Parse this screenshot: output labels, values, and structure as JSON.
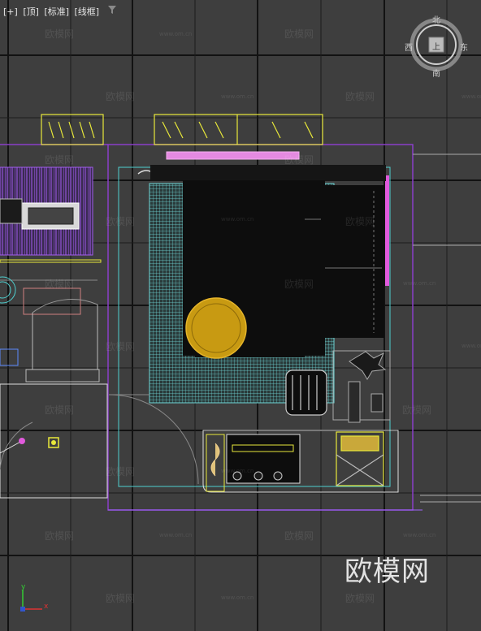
{
  "viewport": {
    "labels": [
      "[+]",
      "[顶]",
      "[标准]",
      "[线框]"
    ],
    "filter_icon": "funnel-icon"
  },
  "viewcube": {
    "north": "北",
    "south": "南",
    "west": "西",
    "east": "东",
    "face": "上"
  },
  "watermarks": {
    "brand": "欧模网",
    "url": "www.om.cn",
    "big": "欧模网"
  },
  "axis": {
    "x": "x",
    "y": "y"
  },
  "colors": {
    "background": "#3e3e3e",
    "grid": "#111111",
    "accent_yellow": "#e8e83a",
    "accent_magenta": "#e05adc",
    "accent_cyan": "#4fd0d0",
    "accent_purple": "#8a3fc9"
  }
}
